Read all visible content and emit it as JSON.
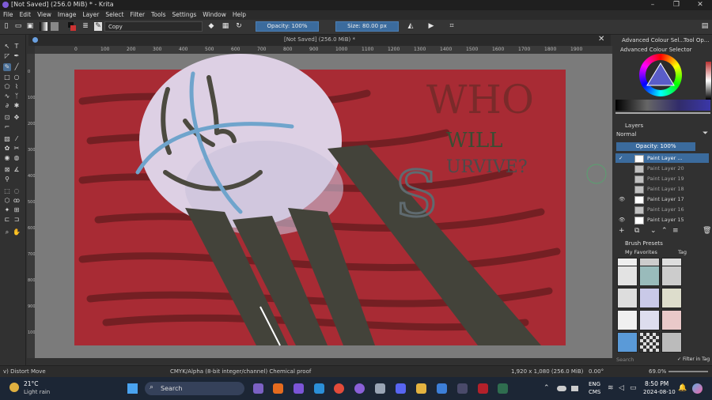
{
  "window": {
    "title": "[Not Saved]  (256.0 MiB) * - Krita",
    "controls": {
      "minimize": "–",
      "maximize": "❐",
      "close": "✕"
    }
  },
  "menu": [
    "File",
    "Edit",
    "View",
    "Image",
    "Layer",
    "Select",
    "Filter",
    "Tools",
    "Settings",
    "Window",
    "Help"
  ],
  "toolbar": {
    "blend_mode": "Copy",
    "opacity_label": "Opacity: 100%",
    "size_label": "Size: 80.00 px"
  },
  "document": {
    "tab_title": "[Not Saved]  (256.0 MiB) *",
    "ruler_ticks": [
      "0",
      "100",
      "200",
      "300",
      "400",
      "500",
      "600",
      "700",
      "800",
      "900",
      "1000",
      "1100",
      "1200",
      "1300",
      "1400",
      "1500",
      "1600",
      "1700",
      "1800",
      "1900"
    ],
    "vruler_ticks": [
      "0",
      "100",
      "200",
      "300",
      "400",
      "500",
      "600",
      "700",
      "800",
      "900",
      "1000"
    ],
    "canvas_text": {
      "who": "WHO",
      "will": "WILL",
      "s": "S",
      "urvive": "URVIVE?"
    }
  },
  "dockers": {
    "tabs": [
      "Advanced Colour Sel...",
      "Tool Op..."
    ],
    "colour_selector_title": "Advanced Colour Selector",
    "layers": {
      "title": "Layers",
      "blend_mode": "Normal",
      "opacity_label": "Opacity:  100%",
      "items": [
        {
          "name": "Paint Layer ..."
        },
        {
          "name": "Paint Layer 20"
        },
        {
          "name": "Paint Layer 19"
        },
        {
          "name": "Paint Layer 18"
        },
        {
          "name": "Paint Layer 17"
        },
        {
          "name": "Paint Layer 16"
        },
        {
          "name": "Paint Layer 15"
        }
      ]
    },
    "brush_presets": {
      "title": "Brush Presets",
      "tag": "My Favorites",
      "tag_button": "Tag",
      "search_placeholder": "Search",
      "filter_label": "Filter in Tag"
    }
  },
  "status": {
    "tool": "v) Distort Move",
    "color_model": "CMYK/Alpha (8-bit integer/channel)  Chemical proof",
    "dimensions": "1,920 x 1,080 (256.0 MiB)",
    "rotation": "0.00°",
    "zoom": "69.0%"
  },
  "taskbar": {
    "weather_temp": "21°C",
    "weather_desc": "Light rain",
    "search": "Search",
    "lang1": "ENG",
    "lang2": "CMS",
    "time": "8:50 PM",
    "date": "2024-08-10"
  }
}
